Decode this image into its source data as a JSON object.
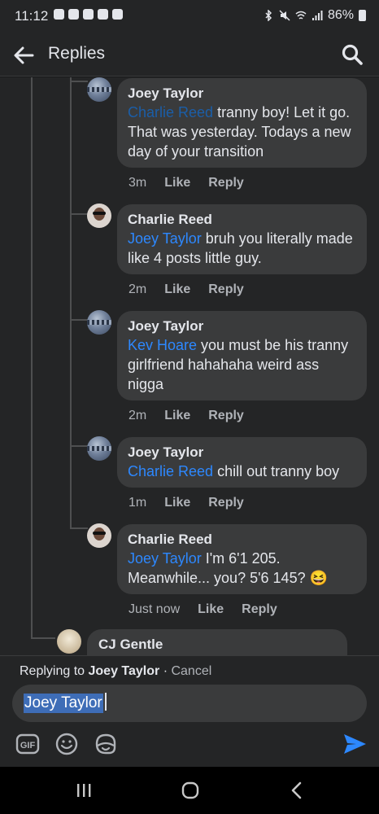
{
  "status_bar": {
    "time": "11:12",
    "battery": "86%"
  },
  "header": {
    "title": "Replies"
  },
  "comments": [
    {
      "author": "Joey Taylor",
      "mention": "Charlie Reed",
      "text": " tranny boy! Let it go. That was yesterday. Todays a new day of your transition",
      "time": "3m",
      "like": "Like",
      "reply": "Reply"
    },
    {
      "author": "Charlie Reed",
      "mention": "Joey Taylor",
      "text": " bruh you literally made like 4 posts little guy.",
      "time": "2m",
      "like": "Like",
      "reply": "Reply"
    },
    {
      "author": "Joey Taylor",
      "mention": "Kev Hoare",
      "text": " you must be his tranny girlfriend hahahaha weird ass nigga",
      "time": "2m",
      "like": "Like",
      "reply": "Reply"
    },
    {
      "author": "Joey Taylor",
      "mention": "Charlie Reed",
      "text": " chill out tranny boy",
      "time": "1m",
      "like": "Like",
      "reply": "Reply"
    },
    {
      "author": "Charlie Reed",
      "mention": "Joey Taylor",
      "text": " I'm 6'1 205. Meanwhile... you? 5'6 145? 😆",
      "time": "Just now",
      "like": "Like",
      "reply": "Reply"
    }
  ],
  "next_comment": {
    "author": "CJ Gentle"
  },
  "composer": {
    "replying_prefix": "Replying to",
    "replying_to": "Joey Taylor",
    "separator": " · ",
    "cancel": "Cancel",
    "input_value": "Joey Taylor",
    "gif_label": "GIF"
  },
  "colors": {
    "background": "#242526",
    "bubble": "#3a3b3c",
    "mention": "#2d88ff",
    "send": "#2d88ff"
  }
}
